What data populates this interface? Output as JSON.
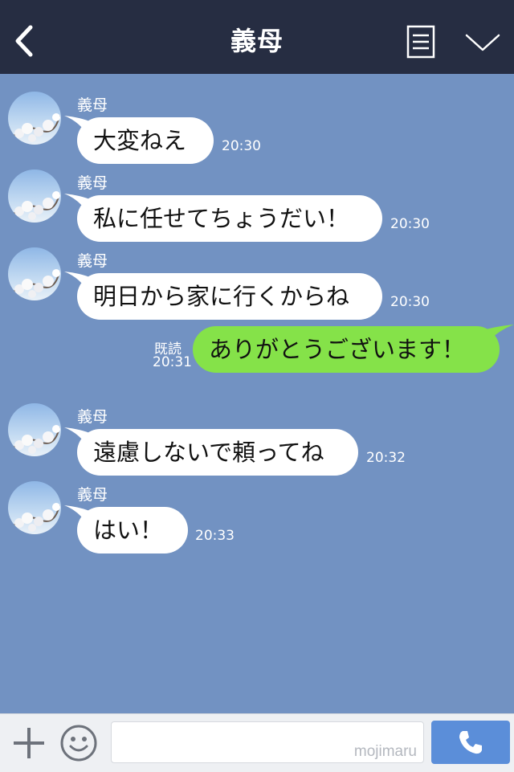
{
  "header": {
    "title": "義母",
    "icons": {
      "back": "chevron-left-icon",
      "menu": "menu-list-icon",
      "expand": "chevron-down-icon"
    }
  },
  "messages": [
    {
      "sender": "義母",
      "text": "大変ねえ",
      "time": "20:30"
    },
    {
      "sender": "義母",
      "text": "私に任せてちょうだい！",
      "time": "20:30"
    },
    {
      "sender": "義母",
      "text": "明日から家に行くからね",
      "time": "20:30"
    },
    {
      "sender": "義母",
      "text": "遠慮しないで頼ってね",
      "time": "20:32"
    },
    {
      "sender": "義母",
      "text": "はい！",
      "time": "20:33"
    }
  ],
  "sent_message": {
    "text": "ありがとうございます！",
    "read_label": "既読",
    "time": "20:31"
  },
  "input_bar": {
    "watermark": "mojimaru",
    "icons": {
      "add": "plus-icon",
      "sticker": "smiley-icon",
      "call": "phone-icon"
    }
  },
  "colors": {
    "header": "#262d42",
    "chat_background": "#7292c2",
    "sent_bubble": "#85e249",
    "call_button": "#5b8ed9"
  }
}
